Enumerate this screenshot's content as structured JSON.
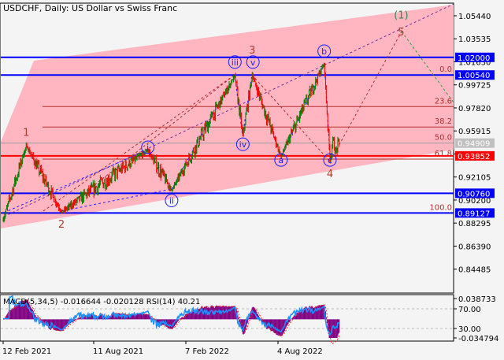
{
  "header": {
    "title": "USDCHF, Daily:  US Dollar vs Swiss Franc"
  },
  "colors": {
    "channel": "#ffb6c1",
    "level_line": "#0000ff",
    "support_line": "#ff0000",
    "fib": "#b03030",
    "bull": "#008000",
    "bear": "#ff0000",
    "macd_hist": "#800080",
    "rsi": "#1e90ff",
    "wave_major": "#b03a2e",
    "wave_minor": "#1c1cff",
    "wave_degree": "#2e8b57"
  },
  "chart_data": {
    "type": "candlestick",
    "symbol": "USDCHF",
    "timeframe": "Daily",
    "ylim": [
      0.8354,
      1.0645
    ],
    "y_ticks": [
      "1.05440",
      "1.03535",
      "1.01630",
      "0.99725",
      "0.97820",
      "0.95915",
      "0.94010",
      "0.92105",
      "0.90200",
      "0.88295",
      "0.86390",
      "0.84485"
    ],
    "x_ticks": [
      "12 Feb 2021",
      "11 Aug 2021",
      "7 Feb 2022",
      "4 Aug 2022"
    ],
    "pivots": [
      [
        0,
        0.885
      ],
      [
        32,
        0.947
      ],
      [
        81,
        0.892
      ],
      [
        201,
        0.943
      ],
      [
        234,
        0.91
      ],
      [
        322,
        1.005
      ],
      [
        333,
        0.955
      ],
      [
        346,
        1.005
      ],
      [
        386,
        0.938
      ],
      [
        446,
        1.015
      ],
      [
        454,
        0.935
      ],
      [
        458,
        0.952
      ],
      [
        462,
        0.943
      ],
      [
        468,
        0.949
      ]
    ],
    "levels": [
      {
        "price": "1.02000",
        "color": "#0000ff"
      },
      {
        "price": "1.00540",
        "color": "#0000ff"
      },
      {
        "price": "0.94909",
        "color": "#c0c0c0"
      },
      {
        "price": "0.93852",
        "color": "#ff0000"
      },
      {
        "price": "0.90760",
        "color": "#0000ff"
      },
      {
        "price": "0.89127",
        "color": "#0000ff"
      }
    ],
    "fibonacci": [
      {
        "label": "0.0",
        "price": 1.0054
      },
      {
        "label": "23.6",
        "price": 0.9793
      },
      {
        "label": "38.2",
        "price": 0.9624
      },
      {
        "label": "50.0",
        "price": 0.9491
      },
      {
        "label": "61.8",
        "price": 0.9358
      },
      {
        "label": "100.0",
        "price": 0.8913
      }
    ],
    "waves": [
      {
        "label": "1",
        "bar": 32,
        "price": 0.955,
        "kind": "major"
      },
      {
        "label": "2",
        "bar": 81,
        "price": 0.879,
        "kind": "major"
      },
      {
        "label": "3",
        "bar": 346,
        "price": 1.023,
        "kind": "major"
      },
      {
        "label": "4",
        "bar": 454,
        "price": 0.921,
        "kind": "major"
      },
      {
        "label": "5",
        "bar": 553,
        "price": 1.038,
        "kind": "major"
      },
      {
        "label": "(1)",
        "bar": 553,
        "price": 1.052,
        "kind": "degree"
      },
      {
        "label": "i",
        "bar": 201,
        "price": 0.943,
        "kind": "minor"
      },
      {
        "label": "ii",
        "bar": 234,
        "price": 0.899,
        "kind": "minor"
      },
      {
        "label": "iii",
        "bar": 322,
        "price": 1.0135,
        "kind": "minor"
      },
      {
        "label": "iv",
        "bar": 333,
        "price": 0.9455,
        "kind": "minor"
      },
      {
        "label": "v",
        "bar": 347,
        "price": 1.0135,
        "kind": "minor"
      },
      {
        "label": "a",
        "bar": 386,
        "price": 0.9325,
        "kind": "minor"
      },
      {
        "label": "b",
        "bar": 446,
        "price": 1.0225,
        "kind": "minor"
      },
      {
        "label": "c",
        "bar": 454,
        "price": 0.9325,
        "kind": "minor"
      }
    ],
    "indicator": {
      "label": "MACD(5,34,5) -0.016644 -0.020128 RSI(14) 40.21",
      "y_ticks": [
        "0.038733",
        "70.00",
        "30.00",
        "-0.034794"
      ],
      "macd_range": [
        -0.034794,
        0.038733
      ]
    }
  }
}
